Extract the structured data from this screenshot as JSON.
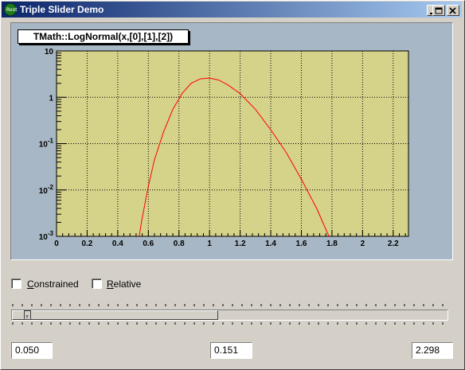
{
  "window": {
    "title": "Triple Slider Demo",
    "icon_name": "root-app-icon",
    "icon_text": "Root",
    "controls": [
      "minimize-icon",
      "maximize-icon",
      "close-icon"
    ]
  },
  "canvas": {
    "function_title": "TMath::LogNormal(x,[0],[1],[2])",
    "background_color": "#a7b7c5",
    "frame_fill_color": "#d5d28a",
    "curve_color": "#ff0000"
  },
  "chart_data": {
    "type": "line",
    "title": "TMath::LogNormal(x,[0],[1],[2])",
    "xlabel": "",
    "ylabel": "",
    "x_scale": "linear",
    "y_scale": "log",
    "xlim": [
      0,
      2.3
    ],
    "ylim": [
      0.001,
      10
    ],
    "grid": true,
    "x_ticks": [
      "0",
      "0.2",
      "0.4",
      "0.6",
      "0.8",
      "1",
      "1.2",
      "1.4",
      "1.6",
      "1.8",
      "2",
      "2.2"
    ],
    "y_ticks": [
      "10^-3",
      "10^-2",
      "10^-1",
      "1",
      "10"
    ],
    "series": [
      {
        "x": [
          0.54,
          0.56,
          0.6,
          0.64,
          0.7,
          0.76,
          0.82,
          0.88,
          0.94,
          1.0,
          1.06,
          1.12,
          1.2,
          1.3,
          1.4,
          1.5,
          1.6,
          1.7,
          1.78
        ],
        "y": [
          0.001,
          0.0025,
          0.012,
          0.045,
          0.18,
          0.55,
          1.2,
          2.0,
          2.5,
          2.6,
          2.35,
          1.85,
          1.2,
          0.55,
          0.2,
          0.065,
          0.017,
          0.004,
          0.001
        ]
      }
    ]
  },
  "checkboxes": [
    {
      "label": "Constrained",
      "checked": false,
      "shortcut": "C"
    },
    {
      "label": "Relative",
      "checked": false,
      "shortcut": "R"
    }
  ],
  "slider": {
    "min_value": "0.050",
    "pointer_value": "0.151",
    "max_value": "2.298"
  }
}
